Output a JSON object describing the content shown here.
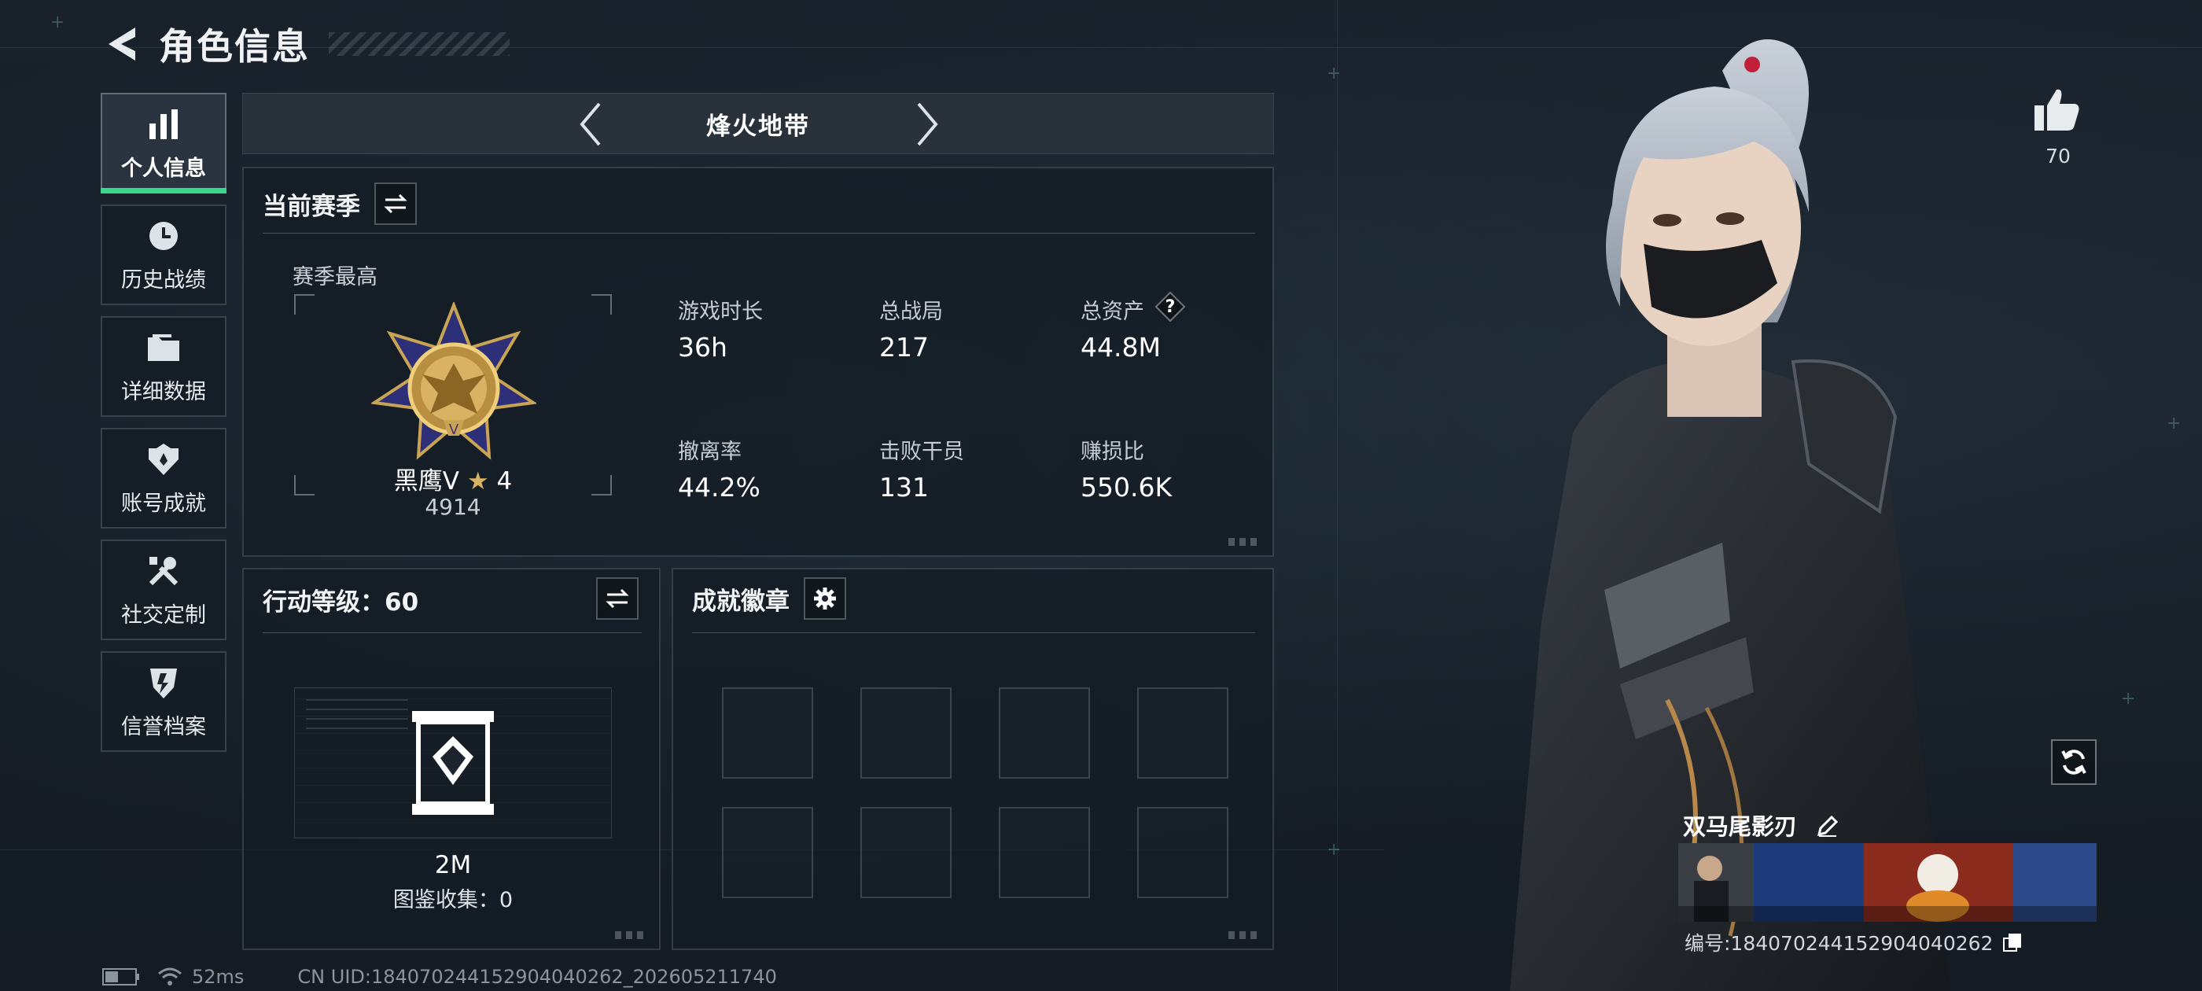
{
  "header": {
    "title": "角色信息"
  },
  "sidebar": {
    "items": [
      {
        "label": "个人信息",
        "icon": "bar-chart-icon",
        "active": true
      },
      {
        "label": "历史战绩",
        "icon": "history-clock-icon"
      },
      {
        "label": "详细数据",
        "icon": "folder-icon"
      },
      {
        "label": "账号成就",
        "icon": "achievement-badge-icon"
      },
      {
        "label": "社交定制",
        "icon": "tools-icon"
      },
      {
        "label": "信誉档案",
        "icon": "reputation-shield-icon"
      }
    ]
  },
  "mode": {
    "title": "烽火地带"
  },
  "season": {
    "title": "当前赛季",
    "best_label": "赛季最高",
    "rank_name": "黑鹰V",
    "rank_stars": "4",
    "rank_points": "4914",
    "stats": [
      {
        "label": "游戏时长",
        "value": "36h"
      },
      {
        "label": "总战局",
        "value": "217"
      },
      {
        "label": "总资产",
        "value": "44.8M",
        "help": "?"
      },
      {
        "label": "撤离率",
        "value": "44.2%"
      },
      {
        "label": "击败干员",
        "value": "131"
      },
      {
        "label": "赚损比",
        "value": "550.6K"
      }
    ]
  },
  "action_level": {
    "title": "行动等级：60",
    "value": "2M",
    "collection_label": "图鉴收集：0"
  },
  "achievements": {
    "title": "成就徽章",
    "slot_count": 8
  },
  "profile": {
    "likes": "70",
    "card_name": "双马尾影刃",
    "card_id": "编号:1840702441529040402​62"
  },
  "status": {
    "ping": "52ms",
    "uid": "CN UID:1840702441529040402​62_202605211740"
  },
  "colors": {
    "accent": "#39d98a",
    "background": "#161d26",
    "panel": "#29313b",
    "gold": "#d2a24c"
  }
}
